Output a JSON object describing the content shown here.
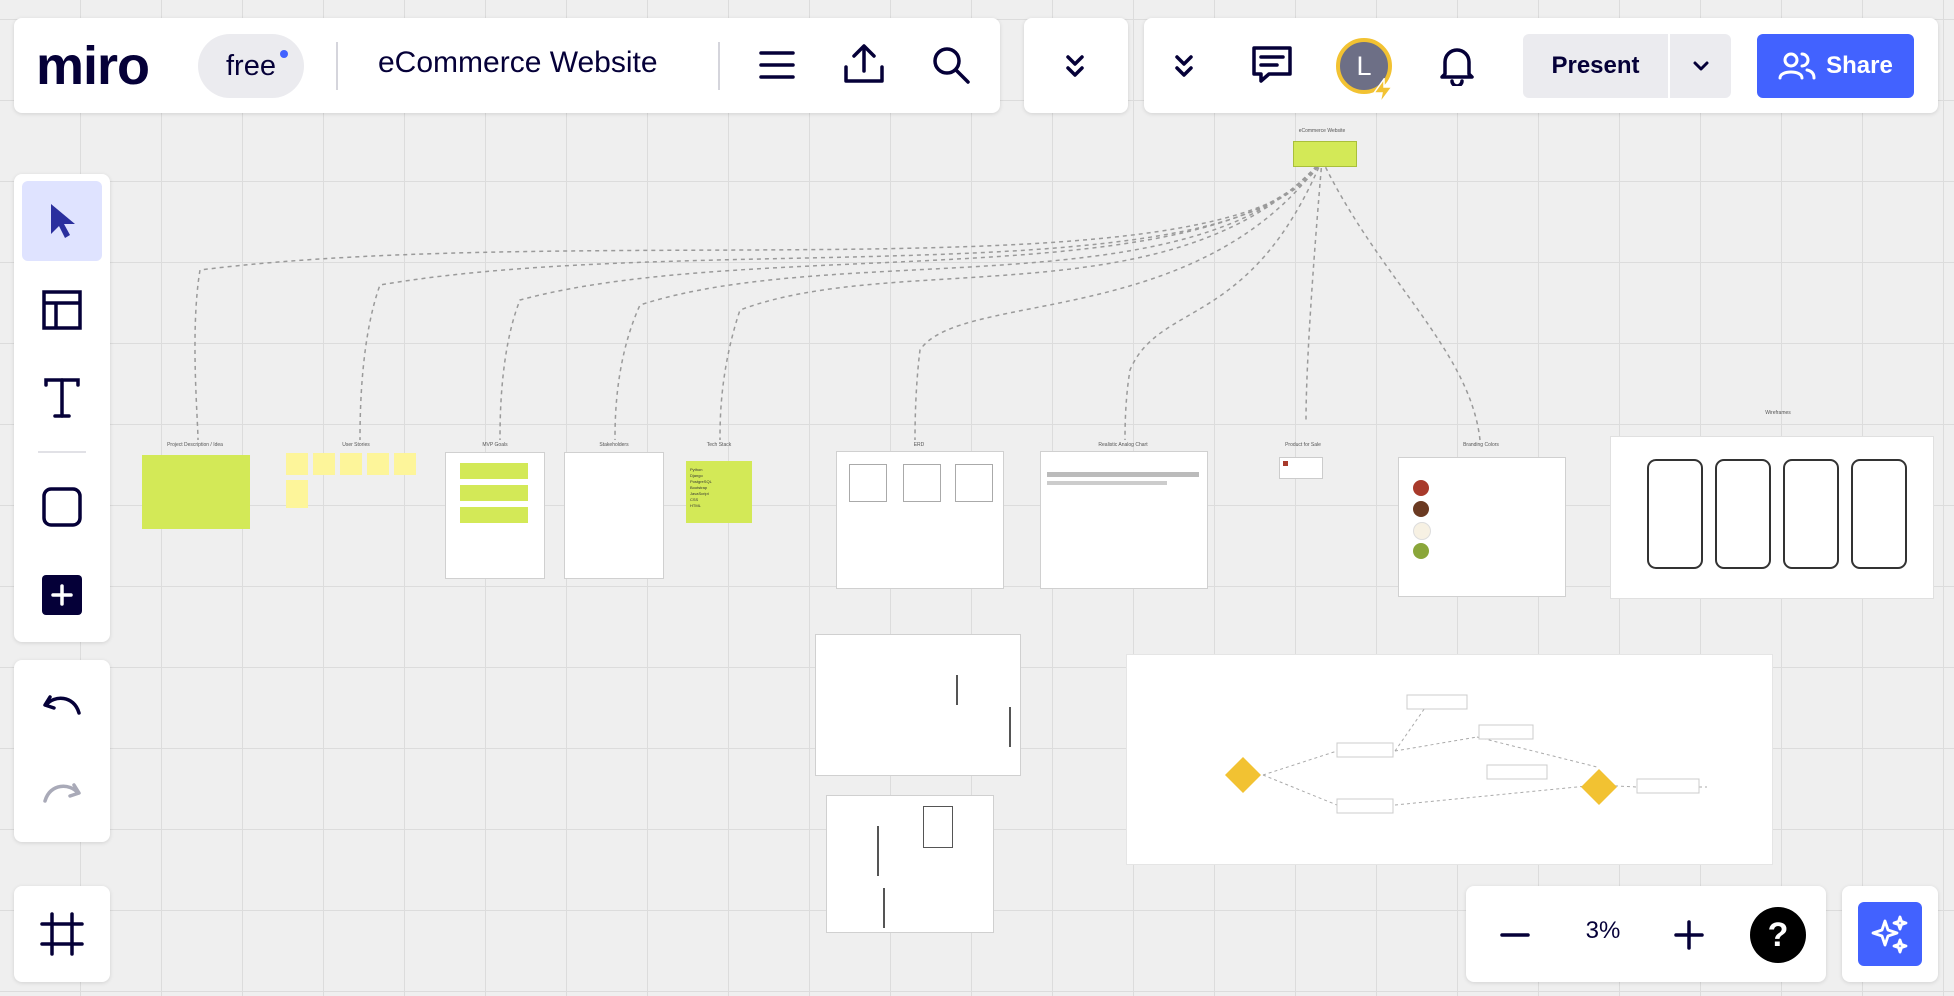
{
  "app": {
    "logo": "miro",
    "plan_badge": "free"
  },
  "board": {
    "title": "eCommerce Website"
  },
  "header": {
    "present_label": "Present",
    "share_label": "Share",
    "avatar_initial": "L"
  },
  "zoom": {
    "level": "3%"
  },
  "help": {
    "label": "?"
  },
  "colors": {
    "brand_blue": "#4262ff",
    "sticky_green": "#d3e957",
    "sticky_yellow": "#fdf59a",
    "decision_yellow": "#f2c232",
    "avatar_ring": "#f2c232"
  },
  "toolbar": {
    "tools": [
      {
        "name": "select",
        "icon": "cursor-icon",
        "active": true
      },
      {
        "name": "templates",
        "icon": "layout-icon"
      },
      {
        "name": "text",
        "icon": "text-icon"
      },
      {
        "name": "shapes",
        "icon": "square-icon"
      },
      {
        "name": "more",
        "icon": "plus-icon"
      }
    ],
    "history": [
      {
        "name": "undo",
        "icon": "undo-icon"
      },
      {
        "name": "redo",
        "icon": "redo-icon",
        "disabled": true
      }
    ],
    "frames_icon": "frame-icon"
  },
  "board_labels": {
    "root": "eCommerce Website",
    "frames": [
      "Project Description / Idea",
      "User Stories",
      "MVP Goals",
      "Stakeholders",
      "Tech Stack",
      "ERD",
      "Realistic Analog Chart",
      "Product for Sale",
      "Branding Colors",
      "Wireframes"
    ],
    "tech_stack": [
      "Python",
      "Django",
      "PostgreSQL",
      "Bootstrap",
      "JavaScript",
      "CSS",
      "HTML"
    ],
    "brand_colors": [
      "#a83a2b",
      "#6b3a22",
      "#f7f1e3",
      "#8aa63a"
    ],
    "wireframe_screens": 4
  }
}
